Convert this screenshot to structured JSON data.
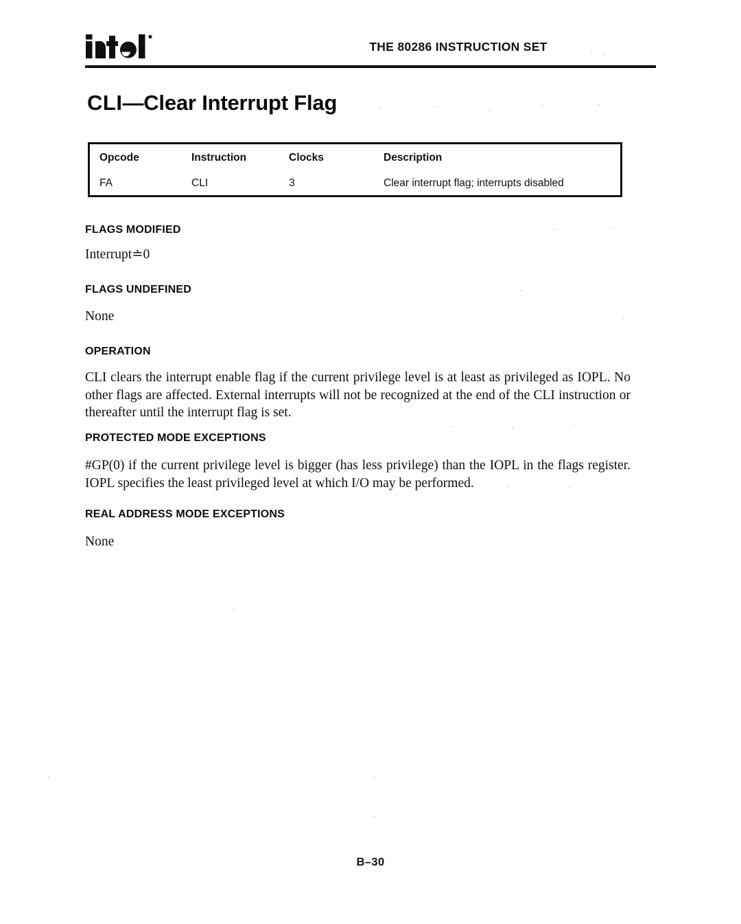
{
  "header": {
    "logo_name": "intel-logo",
    "logo_text": "intel",
    "running_head": "THE 80286 INSTRUCTION SET"
  },
  "title": {
    "mnemonic": "CLI",
    "separator": "—",
    "name": "Clear Interrupt Flag",
    "full": "CLI—Clear Interrupt Flag"
  },
  "opcode_table": {
    "columns": [
      "Opcode",
      "Instruction",
      "Clocks",
      "Description"
    ],
    "rows": [
      {
        "opcode": "FA",
        "instruction": "CLI",
        "clocks": "3",
        "description": "Clear interrupt flag; interrupts disabled"
      }
    ]
  },
  "sections": [
    {
      "id": "flags-modified",
      "heading": "FLAGS MODIFIED",
      "body": "Interrupt≐0"
    },
    {
      "id": "flags-undefined",
      "heading": "FLAGS UNDEFINED",
      "body": "None"
    },
    {
      "id": "operation",
      "heading": "OPERATION",
      "body": "CLI clears the interrupt enable flag if the current privilege level is at least as privileged as IOPL. No other flags are affected. External interrupts will not be recognized at the end of the CLI instruction or thereafter until the interrupt flag is set."
    },
    {
      "id": "protected-mode-exceptions",
      "heading": "PROTECTED MODE EXCEPTIONS",
      "body": "#GP(0) if the current privilege level is bigger (has less privilege) than the IOPL in the flags register. IOPL specifies the least privileged level at which I/O may be performed."
    },
    {
      "id": "real-address-mode-exceptions",
      "heading": "REAL ADDRESS MODE EXCEPTIONS",
      "body": "None"
    }
  ],
  "footer": {
    "page_number": "B–30"
  },
  "colors": {
    "page_background": "#ffffff",
    "ink": "#101010",
    "rule": "#101010",
    "table_border": "#111111"
  }
}
